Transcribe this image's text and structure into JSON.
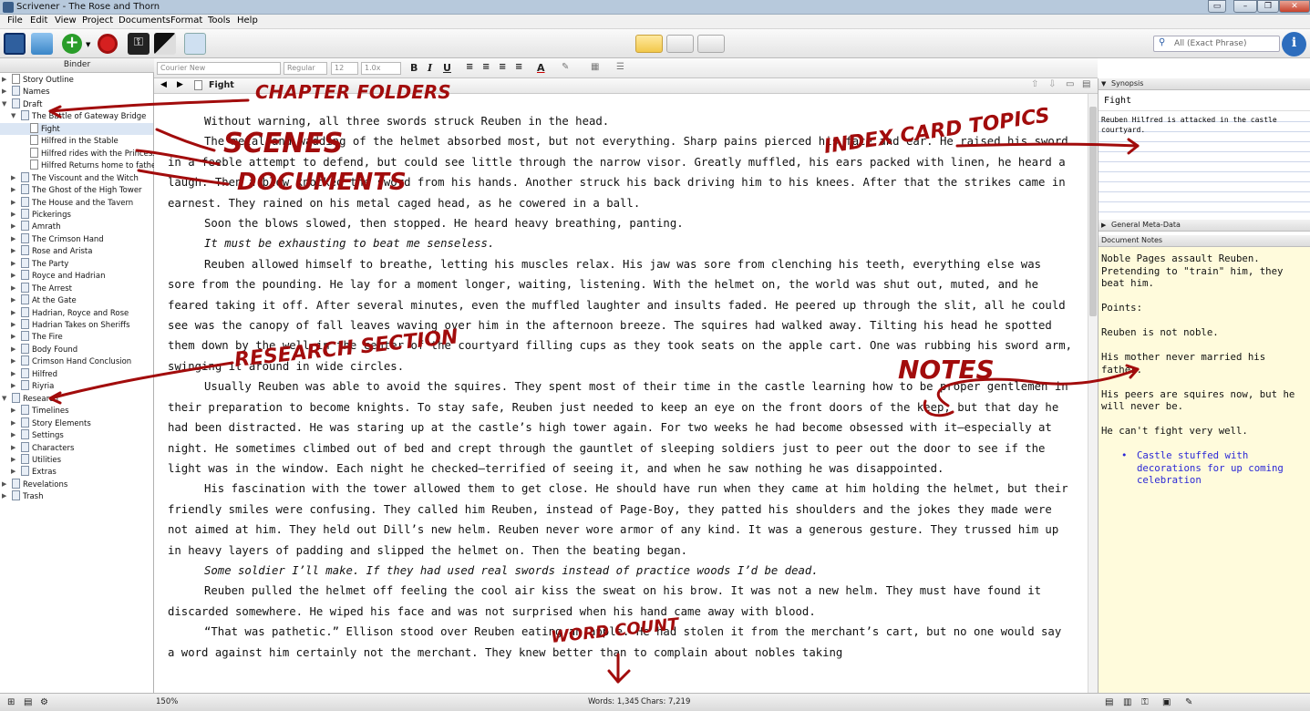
{
  "window": {
    "title": "Scrivener - The Rose and Thorn"
  },
  "menu": [
    "File",
    "Edit",
    "View",
    "Project",
    "Documents",
    "Format",
    "Tools",
    "Help"
  ],
  "toolbar": {
    "search_placeholder": "All (Exact Phrase)"
  },
  "binder": {
    "header": "Binder",
    "items": [
      "Story Outline",
      "Names",
      "Draft",
      "The Battle of Gateway Bridge",
      "Fight",
      "Hilfred in the Stable",
      "Hilfred rides with the Princess",
      "Hilfred Returns home to father",
      "The Viscount and the Witch",
      "The Ghost of the High Tower",
      "The House and the Tavern",
      "Pickerings",
      "Amrath",
      "The Crimson Hand",
      "Rose and Arista",
      "The Party",
      "Royce and Hadrian",
      "The Arrest",
      "At the Gate",
      "Hadrian, Royce and Rose",
      "Hadrian Takes on Sheriffs",
      "The Fire",
      "Body Found",
      "Crimson Hand Conclusion",
      "Hilfred",
      "Riyria",
      "Research",
      "Timelines",
      "Story Elements",
      "Settings",
      "Characters",
      "Utilities",
      "Extras",
      "Revelations",
      "Trash"
    ]
  },
  "format": {
    "font": "Courier New",
    "style": "Regular",
    "size": "12",
    "spacing": "1.0x"
  },
  "editor": {
    "doc_title": "Fight",
    "paragraphs": [
      "Without warning, all three swords struck Reuben in the head.",
      "The metal and wadding of the helmet absorbed most, but not everything. Sharp pains pierced his face and ear. He raised his sword in a feeble attempt to defend, but could see little through the narrow visor. Greatly muffled, his ears packed with linen, he heard a laugh. Then a blow knocked the sword from his hands. Another struck his back driving him to his knees. After that the strikes came in earnest. They rained on his metal caged head, as he cowered in a ball.",
      "Soon the blows slowed, then stopped. He heard heavy breathing, panting.",
      "It must be exhausting to beat me senseless.",
      "Reuben allowed himself to breathe, letting his muscles relax. His jaw was sore from clenching his teeth, everything else was sore from the pounding. He lay for a moment longer, waiting, listening. With the helmet on, the world was shut out, muted, and he feared taking it off. After several minutes, even the muffled laughter and insults faded. He peered up through the slit, all he could see was the canopy of fall leaves waving over him in the afternoon breeze. The squires had walked away. Tilting his head he spotted them down by the well in the center of the courtyard filling cups as they took seats on the apple cart. One was rubbing his sword arm, swinging it around in wide circles.",
      "Usually Reuben was able to avoid the squires. They spent most of their time in the castle learning how to be proper gentlemen in their preparation to become knights. To stay safe, Reuben just needed to keep an eye on the front doors of the keep, but that day he had been distracted. He was staring up at the castle’s high tower again. For two weeks he had become obsessed with it—especially at night. He sometimes climbed out of bed and crept through the gauntlet of sleeping soldiers just to peer out the door to see if the light was in the window. Each night he checked—terrified of seeing it, and when he saw nothing he was disappointed.",
      "His fascination with the tower allowed them to get close. He should have run when they came at him holding the helmet, but their friendly smiles were confusing. They called him Reuben, instead of Page-Boy, they patted his shoulders and the jokes they made were not aimed at him. They held out Dill’s new helm. Reuben never wore armor of any kind. It was a generous gesture. They trussed him up in heavy layers of padding and slipped the helmet on. Then the beating began.",
      "Some soldier I’ll make. If they had used real swords instead of practice woods I’d be dead.",
      "Reuben pulled the helmet off feeling the cool air kiss the sweat on his brow. It was not a new helm. They must have found it discarded somewhere. He wiped his face and was not surprised when his hand came away with blood.",
      "“That was pathetic.” Ellison stood over Reuben eating an apple. He had stolen it from the merchant’s cart, but no one would say a word against him certainly not the merchant. They knew better than to complain about nobles taking"
    ]
  },
  "inspector": {
    "synopsis_header": "Synopsis",
    "synopsis_title": "Fight",
    "synopsis_text": "Reuben Hilfred is attacked in the castle courtyard.",
    "meta_header": "General Meta-Data",
    "notes_header": "Document Notes",
    "notes": [
      "Noble Pages assault Reuben. Pretending to \"train\" him, they beat him.",
      "Points:",
      "Reuben is not noble.",
      "His mother never married his father.",
      "His peers are squires now, but he will never be.",
      "He can't fight very well."
    ],
    "bullet": "Castle stuffed with decorations for up coming celebration"
  },
  "footer": {
    "zoom": "150%",
    "words": "Words: 1,345",
    "chars": "Chars: 7,219"
  },
  "annotations": [
    "CHAPTER FOLDERS",
    "SCENES",
    "DOCUMENTS",
    "INDEX CARD TOPICS",
    "RESEARCH SECTION",
    "NOTES",
    "WORD COUNT"
  ],
  "colors": {
    "ink": "#a20c0c",
    "notes_bg": "#fffbdc",
    "bullet": "#2b28d6"
  }
}
